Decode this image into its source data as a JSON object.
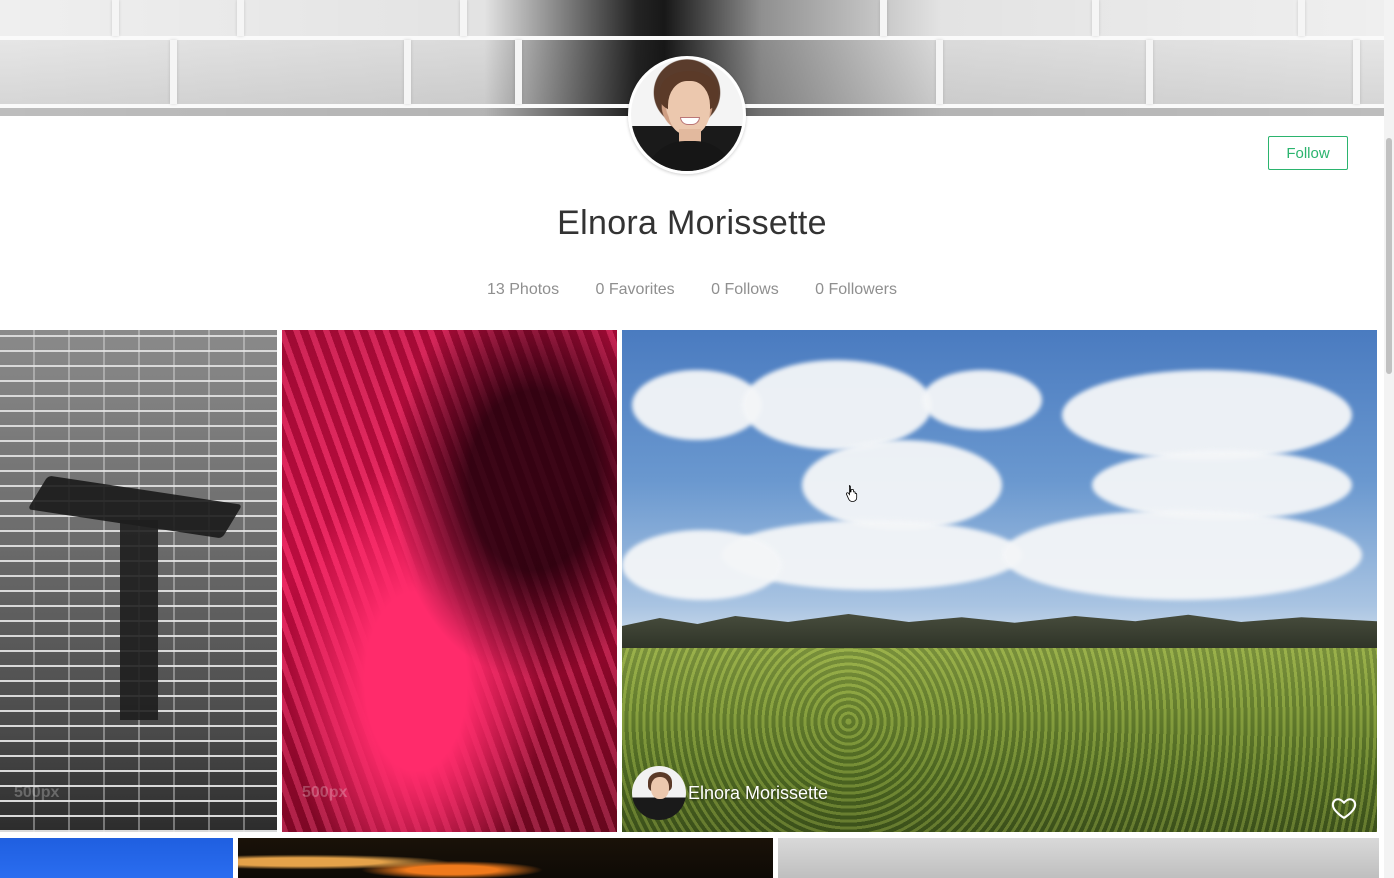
{
  "profile": {
    "name": "Elnora Morissette",
    "follow_label": "Follow"
  },
  "stats": [
    {
      "label": "13 Photos"
    },
    {
      "label": "0 Favorites"
    },
    {
      "label": "0 Follows"
    },
    {
      "label": "0 Followers"
    }
  ],
  "photos": {
    "photo_1": {
      "watermark": "500px"
    },
    "photo_2": {
      "watermark": "500px"
    },
    "photo_3": {
      "owner_name": "Elnora Morissette"
    }
  },
  "colors": {
    "accent": "#2bb46e",
    "text": "#333333",
    "muted": "#8f8f8f"
  },
  "icons": {
    "like": "heart-outline-icon",
    "cursor": "hand-pointer-icon"
  }
}
